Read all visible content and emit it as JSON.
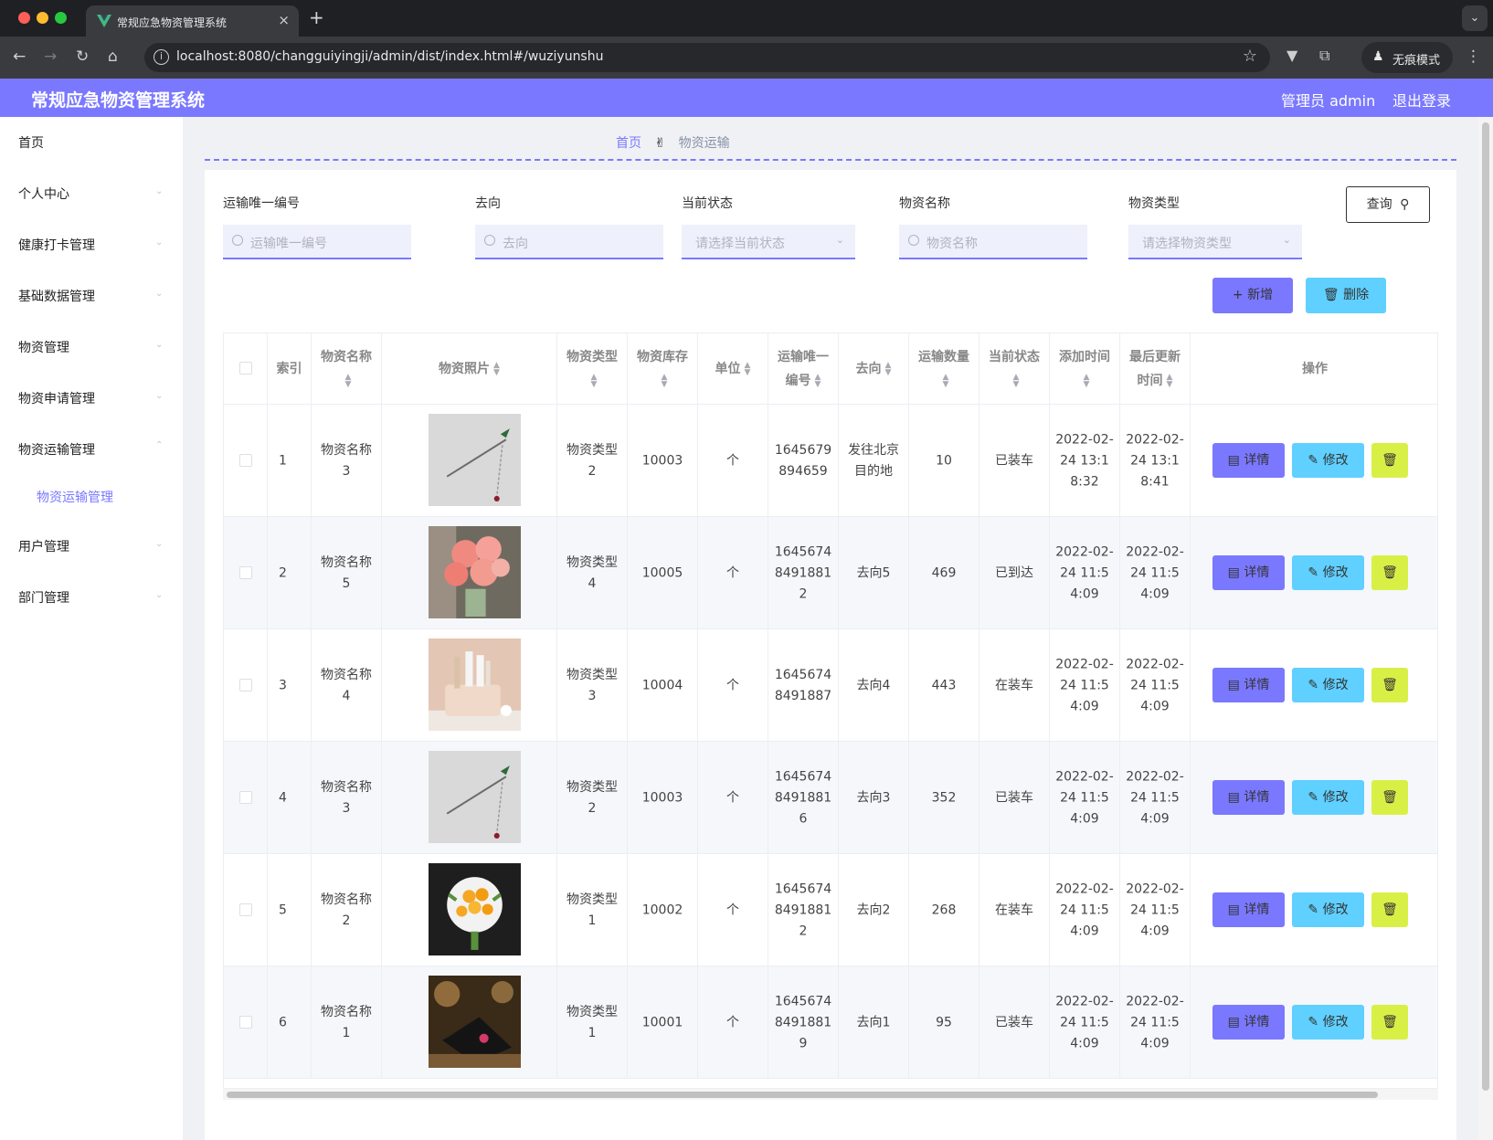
{
  "browser": {
    "tab_title": "常规应急物资管理系统",
    "url": "localhost:8080/changguiyingji/admin/dist/index.html#/wuziyunshu",
    "incognito_label": "无痕模式"
  },
  "header": {
    "title": "常规应急物资管理系统",
    "user_label": "管理员 admin",
    "logout_label": "退出登录"
  },
  "sidebar": {
    "items": [
      "首页",
      "个人中心",
      "健康打卡管理",
      "基础数据管理",
      "物资管理",
      "物资申请管理",
      "物资运输管理",
      "用户管理",
      "部门管理"
    ],
    "subitem": "物资运输管理"
  },
  "breadcrumb": {
    "home": "首页",
    "separator": "✌",
    "current": "物资运输"
  },
  "filters": {
    "transport_id": {
      "label": "运输唯一编号",
      "placeholder": "运输唯一编号"
    },
    "destination": {
      "label": "去向",
      "placeholder": "去向"
    },
    "status": {
      "label": "当前状态",
      "placeholder": "请选择当前状态"
    },
    "name": {
      "label": "物资名称",
      "placeholder": "物资名称"
    },
    "type": {
      "label": "物资类型",
      "placeholder": "请选择物资类型"
    }
  },
  "buttons": {
    "query": "查询",
    "add": "新增",
    "delete": "删除",
    "detail": "详情",
    "edit": "修改"
  },
  "table": {
    "headers": [
      "索引",
      "物资名称",
      "物资照片",
      "物资类型",
      "物资库存",
      "单位",
      "运输唯一编号",
      "去向",
      "运输数量",
      "当前状态",
      "添加时间",
      "最后更新时间",
      "操作"
    ],
    "rows": [
      {
        "index": "1",
        "name": "物资名称3",
        "photo": "hairpin",
        "type": "物资类型2",
        "stock": "10003",
        "unit": "个",
        "transport_id": "1645679894659",
        "destination": "发往北京目的地",
        "qty": "10",
        "status": "已装车",
        "added": "2022-02-24 13:18:32",
        "updated": "2022-02-24 13:18:41"
      },
      {
        "index": "2",
        "name": "物资名称5",
        "photo": "pink-flowers",
        "type": "物资类型4",
        "stock": "10005",
        "unit": "个",
        "transport_id": "16456748491881 2",
        "destination": "去向5",
        "qty": "469",
        "status": "已到达",
        "added": "2022-02-24 11:54:09",
        "updated": "2022-02-24 11:54:09"
      },
      {
        "index": "3",
        "name": "物资名称4",
        "photo": "organizer",
        "type": "物资类型3",
        "stock": "10004",
        "unit": "个",
        "transport_id": "16456748491887",
        "destination": "去向4",
        "qty": "443",
        "status": "在装车",
        "added": "2022-02-24 11:54:09",
        "updated": "2022-02-24 11:54:09"
      },
      {
        "index": "4",
        "name": "物资名称3",
        "photo": "hairpin",
        "type": "物资类型2",
        "stock": "10003",
        "unit": "个",
        "transport_id": "16456748491881 6",
        "destination": "去向3",
        "qty": "352",
        "status": "已装车",
        "added": "2022-02-24 11:54:09",
        "updated": "2022-02-24 11:54:09"
      },
      {
        "index": "5",
        "name": "物资名称2",
        "photo": "bouquet",
        "type": "物资类型1",
        "stock": "10002",
        "unit": "个",
        "transport_id": "16456748491881 2",
        "destination": "去向2",
        "qty": "268",
        "status": "在装车",
        "added": "2022-02-24 11:54:09",
        "updated": "2022-02-24 11:54:09"
      },
      {
        "index": "6",
        "name": "物资名称1",
        "photo": "laptop",
        "type": "物资类型1",
        "stock": "10001",
        "unit": "个",
        "transport_id": "16456748491881 9",
        "destination": "去向1",
        "qty": "95",
        "status": "已装车",
        "added": "2022-02-24 11:54:09",
        "updated": "2022-02-24 11:54:09"
      }
    ]
  },
  "colors": {
    "accent": "#7a78ff",
    "info": "#5fd0ff",
    "warn": "#d8f046"
  }
}
